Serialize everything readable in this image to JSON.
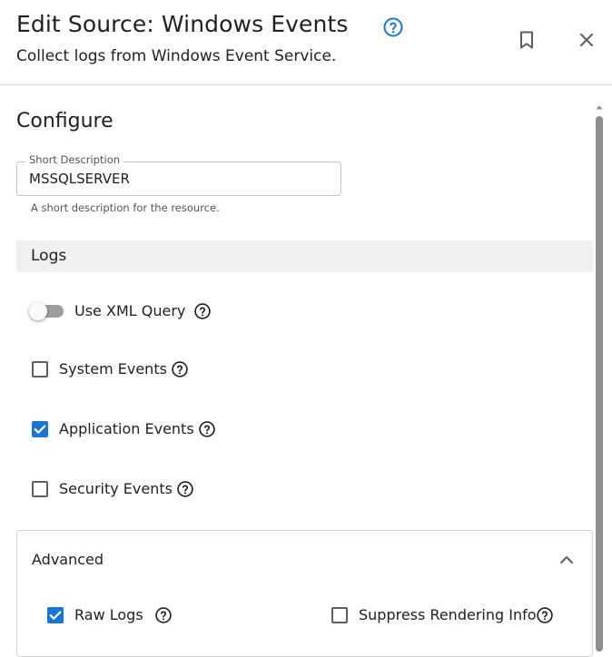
{
  "header": {
    "title": "Edit Source: Windows Events",
    "subtitle": "Collect logs from Windows Event Service."
  },
  "configure": {
    "section_title": "Configure",
    "short_description": {
      "label": "Short Description",
      "value": "MSSQLSERVER",
      "helper": "A short description for the resource."
    }
  },
  "logs": {
    "section_title": "Logs",
    "use_xml_query": {
      "label": "Use XML Query",
      "enabled": false
    },
    "system_events": {
      "label": "System Events",
      "checked": false
    },
    "application_events": {
      "label": "Application Events",
      "checked": true
    },
    "security_events": {
      "label": "Security Events",
      "checked": false
    }
  },
  "advanced": {
    "title": "Advanced",
    "expanded": true,
    "raw_logs": {
      "label": "Raw Logs",
      "checked": true
    },
    "suppress_rendering_info": {
      "label": "Suppress Rendering Info",
      "checked": false
    }
  },
  "colors": {
    "accent": "#1976d2",
    "text": "#212121",
    "divider": "#d6d6d6",
    "band": "#f0f0f0"
  },
  "icons": [
    "help-circle-icon",
    "bookmark-icon",
    "close-icon",
    "check-icon",
    "chevron-up-icon",
    "scroll-up-arrow-icon"
  ]
}
